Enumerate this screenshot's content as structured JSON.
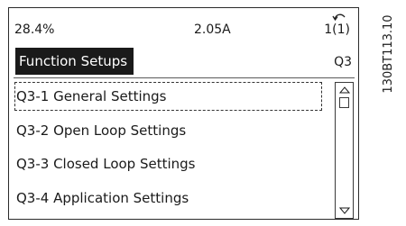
{
  "status_bar": {
    "left_value": "28.4%",
    "middle_value": "2.05A",
    "right_value": "1(1)",
    "back_icon": "back-arrow-icon"
  },
  "title_bar": {
    "title": "Function Setups",
    "code": "Q3"
  },
  "menu": {
    "items": [
      {
        "label": "Q3-1 General Settings",
        "selected": true
      },
      {
        "label": "Q3-2 Open Loop Settings",
        "selected": false
      },
      {
        "label": "Q3-3 Closed Loop Settings",
        "selected": false
      },
      {
        "label": "Q3-4 Application Settings",
        "selected": false
      }
    ]
  },
  "scrollbar": {
    "up_icon": "triangle-up-icon",
    "down_icon": "triangle-down-icon"
  },
  "figure_code": "130BT113.10",
  "colors": {
    "foreground": "#1a1a1a",
    "background": "#ffffff",
    "highlight_bar": "#1a1a1a"
  }
}
